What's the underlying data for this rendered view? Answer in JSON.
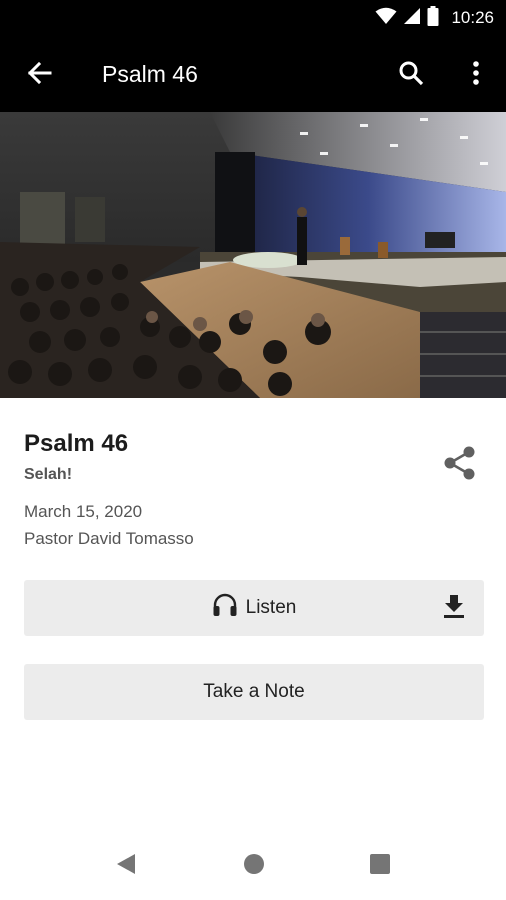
{
  "status_bar": {
    "time": "10:26"
  },
  "app_bar": {
    "title": "Psalm 46"
  },
  "sermon": {
    "title": "Psalm 46",
    "subtitle": "Selah!",
    "date": "March 15, 2020",
    "speaker": "Pastor David Tomasso"
  },
  "actions": {
    "listen_label": "Listen",
    "note_label": "Take a Note"
  },
  "colors": {
    "bar_background": "#000000",
    "button_background": "#ececec",
    "icon_gray": "#606060"
  }
}
